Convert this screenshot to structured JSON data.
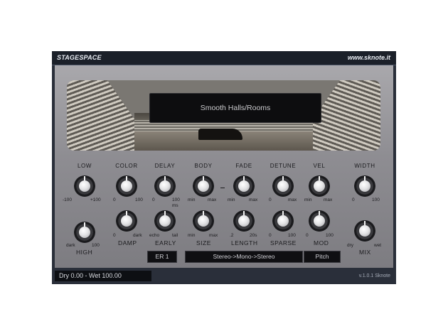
{
  "header": {
    "title": "STAGESPACE",
    "url": "www.sknote.it"
  },
  "preset": {
    "name": "Smooth Halls/Rooms"
  },
  "knobs_row1": [
    {
      "id": "low",
      "label": "LOW",
      "min": "-100",
      "max": "+100"
    },
    {
      "id": "color",
      "label": "COLOR",
      "min": "0",
      "max": "100"
    },
    {
      "id": "delay",
      "label": "DELAY",
      "min": "0",
      "max": "100",
      "unit": "ms"
    },
    {
      "id": "body",
      "label": "BODY",
      "min": "min",
      "max": "max"
    },
    {
      "id": "fade",
      "label": "FADE",
      "min": "min",
      "max": "max"
    },
    {
      "id": "detune",
      "label": "DETUNE",
      "min": "0",
      "max": "max"
    },
    {
      "id": "vel",
      "label": "VEL",
      "min": "min",
      "max": "max"
    },
    {
      "id": "width",
      "label": "WIDTH",
      "min": "0",
      "max": "100"
    }
  ],
  "knobs_row2": [
    {
      "id": "high",
      "label": "HIGH",
      "min": "dark",
      "max": "100"
    },
    {
      "id": "damp",
      "label": "DAMP",
      "min": "0",
      "max": "dark"
    },
    {
      "id": "early",
      "label": "EARLY",
      "min": "echo",
      "max": "tail"
    },
    {
      "id": "size",
      "label": "SIZE",
      "min": "min",
      "max": "max"
    },
    {
      "id": "length",
      "label": "LENGTH",
      "min": ".2",
      "max": "20s"
    },
    {
      "id": "sparse",
      "label": "SPARSE",
      "min": "0",
      "max": "100"
    },
    {
      "id": "mod",
      "label": "MOD",
      "min": "0",
      "max": "100"
    },
    {
      "id": "mix",
      "label": "MIX",
      "min": "dry",
      "max": "wet"
    }
  ],
  "buttons": {
    "er": "ER 1",
    "routing": "Stereo->Mono->Stereo",
    "pitch": "Pitch"
  },
  "status": {
    "text": "Dry 0.00 - Wet 100.00"
  },
  "footer": {
    "version": "v.1.0.1 Sknote"
  }
}
